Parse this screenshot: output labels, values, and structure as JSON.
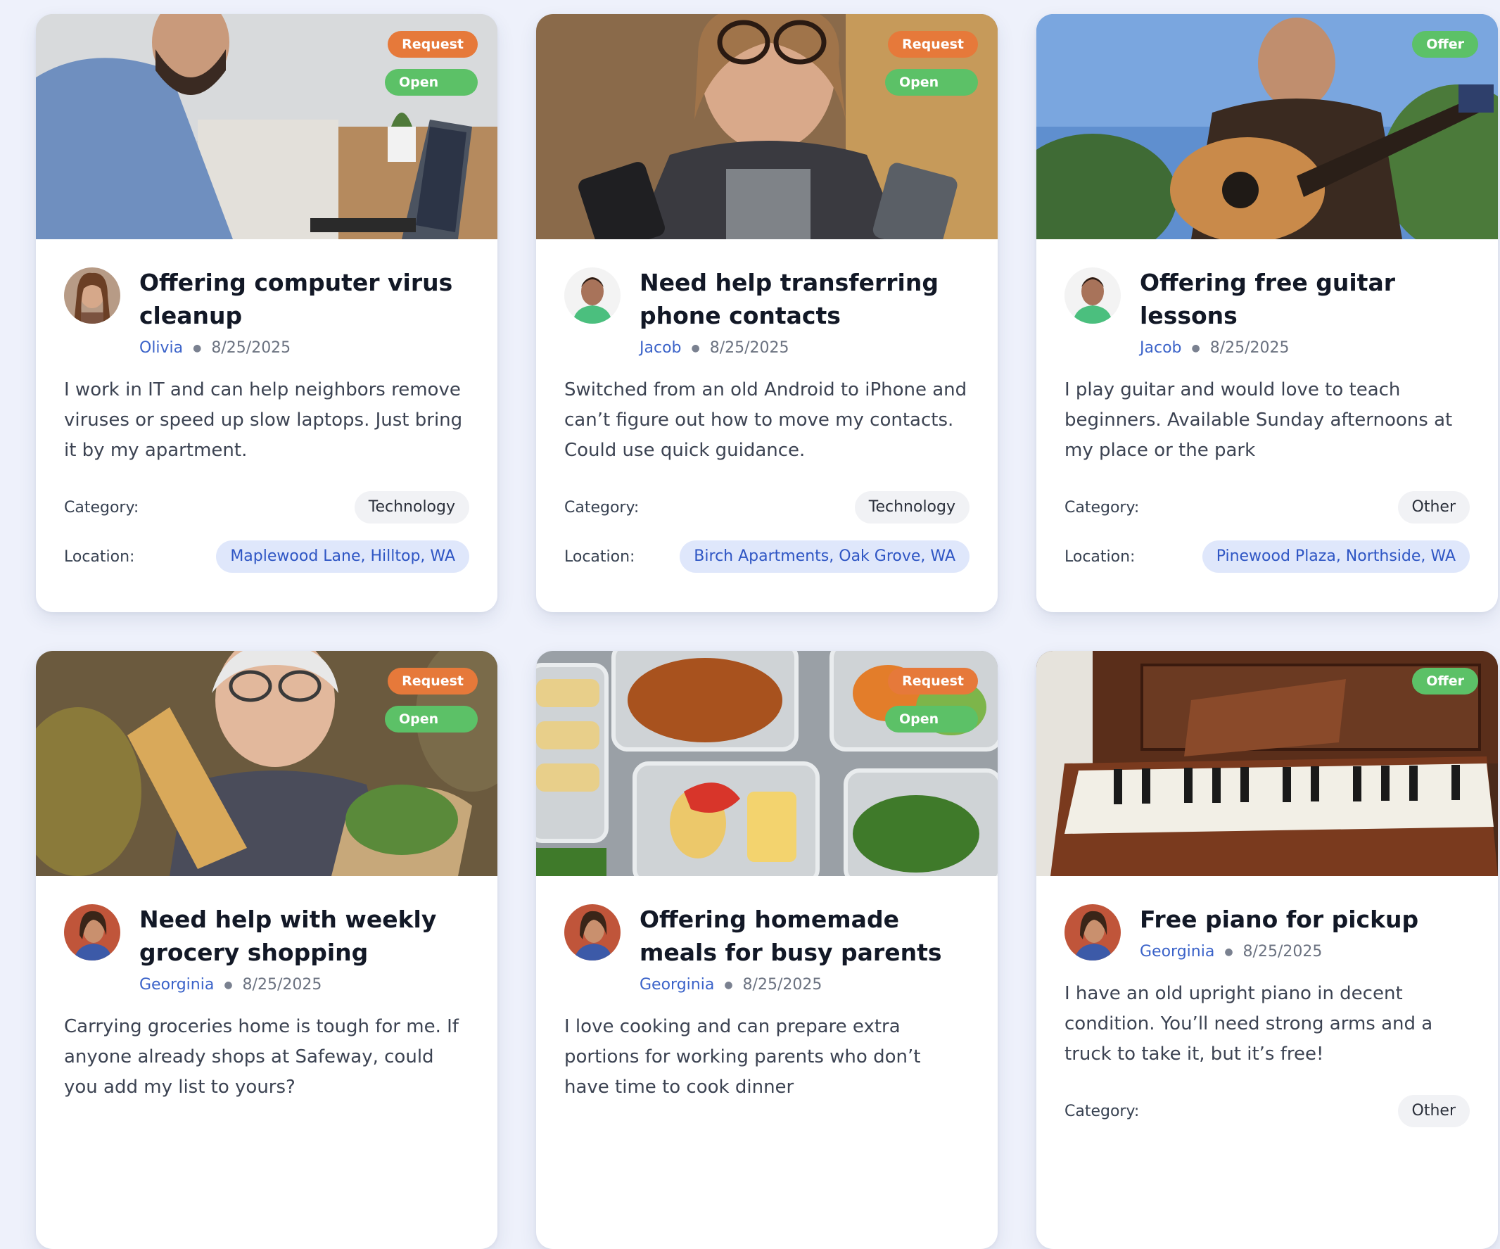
{
  "cards": [
    {
      "type_label": "Request",
      "status_label": "Open",
      "title": "Offering computer virus cleanup",
      "author": "Olivia",
      "date": "8/25/2025",
      "description": "I work in IT and can help neighbors remove viruses or speed up slow laptops. Just bring it by my apartment.",
      "category_label": "Category:",
      "category": "Technology",
      "location_label": "Location:",
      "location": "Maplewood Lane, Hilltop, WA"
    },
    {
      "type_label": "Request",
      "status_label": "Open",
      "title": "Need help transferring phone contacts",
      "author": "Jacob",
      "date": "8/25/2025",
      "description": "Switched from an old Android to iPhone and can’t figure out how to move my contacts. Could use quick guidance.",
      "category_label": "Category:",
      "category": "Technology",
      "location_label": "Location:",
      "location": "Birch Apartments, Oak Grove, WA"
    },
    {
      "type_label": "Offer",
      "title": "Offering free guitar lessons",
      "author": "Jacob",
      "date": "8/25/2025",
      "description": "I play guitar and would love to teach beginners. Available Sunday afternoons at my place or the park",
      "category_label": "Category:",
      "category": "Other",
      "location_label": "Location:",
      "location": "Pinewood Plaza, Northside, WA"
    },
    {
      "type_label": "Request",
      "status_label": "Open",
      "title": "Need help with weekly grocery shopping",
      "author": "Georginia",
      "date": "8/25/2025",
      "description": "Carrying groceries home is tough for me. If anyone already shops at Safeway, could you add my list to yours?"
    },
    {
      "type_label": "Request",
      "status_label": "Open",
      "title": "Offering homemade meals for busy parents",
      "author": "Georginia",
      "date": "8/25/2025",
      "description": "I love cooking and can prepare extra portions for working parents who don’t have time to cook dinner"
    },
    {
      "type_label": "Offer",
      "title": "Free piano for pickup",
      "author": "Georginia",
      "date": "8/25/2025",
      "description": "I have an old upright piano in decent condition. You’ll need strong arms and a truck to take it, but it’s free!",
      "category_label": "Category:",
      "category": "Other"
    }
  ],
  "colors": {
    "request": "#e6793a",
    "offer": "#5cc167",
    "author_link": "#3b63c9",
    "location_chip_bg": "#dfe7fb",
    "page_bg": "#eef1fb"
  }
}
